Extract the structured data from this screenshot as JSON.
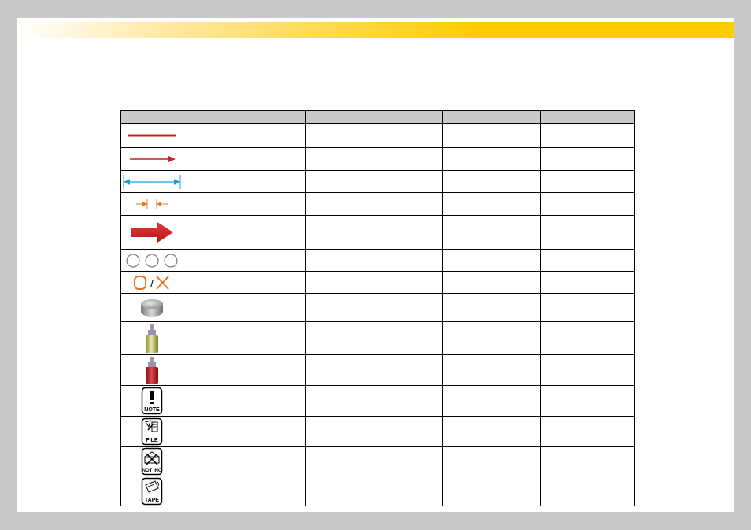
{
  "table": {
    "headers": [
      "",
      "",
      "",
      "",
      ""
    ],
    "rows": [
      {
        "icon": "red-line-icon",
        "cells": [
          "",
          "",
          "",
          ""
        ]
      },
      {
        "icon": "red-arrow-icon",
        "cells": [
          "",
          "",
          "",
          ""
        ]
      },
      {
        "icon": "dimension-arrow-icon",
        "cells": [
          "",
          "",
          "",
          ""
        ]
      },
      {
        "icon": "gap-arrows-icon",
        "cells": [
          "",
          "",
          "",
          ""
        ]
      },
      {
        "icon": "thick-red-arrow-icon",
        "cells": [
          "",
          "",
          "",
          ""
        ]
      },
      {
        "icon": "three-circles-icon",
        "cells": [
          "",
          "",
          "",
          ""
        ]
      },
      {
        "icon": "ok-ng-icon",
        "cells": [
          "",
          "",
          "",
          ""
        ]
      },
      {
        "icon": "metal-puck-icon",
        "cells": [
          "",
          "",
          "",
          ""
        ]
      },
      {
        "icon": "yellow-bottle-icon",
        "cells": [
          "",
          "",
          "",
          ""
        ]
      },
      {
        "icon": "red-bottle-icon",
        "cells": [
          "",
          "",
          "",
          ""
        ]
      },
      {
        "icon": "note-icon",
        "cells": [
          "",
          "",
          "",
          ""
        ]
      },
      {
        "icon": "file-icon",
        "cells": [
          "",
          "",
          "",
          ""
        ]
      },
      {
        "icon": "not-inc-icon",
        "cells": [
          "",
          "",
          "",
          ""
        ]
      },
      {
        "icon": "tape-icon",
        "cells": [
          "",
          "",
          "",
          ""
        ]
      }
    ]
  },
  "icon_labels": {
    "ok_ng_separator": "/",
    "note": "NOTE",
    "file": "FILE",
    "not_inc": "NOT INC",
    "tape": "TAPE"
  },
  "colors": {
    "header_bar": "#ffcc00",
    "table_header_bg": "#c9c9c9",
    "red": "#cc1f25",
    "blue": "#1ca0dc",
    "orange": "#e8741b"
  }
}
